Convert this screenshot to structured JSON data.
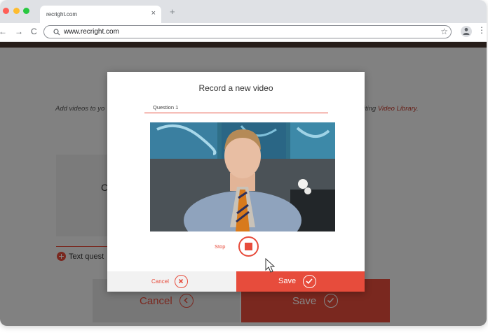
{
  "browser": {
    "tab_title": "recright.com",
    "tab_close": "×",
    "new_tab": "+",
    "back": "←",
    "forward": "→",
    "reload": "C",
    "url": "www.recright.com",
    "bookmark_star": "☆",
    "menu": "⋮"
  },
  "background_page": {
    "intro_left": "Add videos to yo",
    "intro_right_prefix": "siting ",
    "intro_link": "Video Library",
    "intro_right_suffix": ".",
    "box_text": "C",
    "text_question_label": "Text quest",
    "cancel_label": "Cancel",
    "save_label": "Save"
  },
  "modal": {
    "title": "Record a new video",
    "question_placeholder": "Question 1",
    "stop_label": "Stop",
    "cancel_label": "Cancel",
    "save_label": "Save"
  },
  "colors": {
    "accent": "#e74c3c",
    "overlay": "rgba(0,0,0,0.47)"
  },
  "icons": {
    "stop": "stop-square-icon",
    "cancel": "x-circle-icon",
    "save": "check-circle-icon"
  }
}
